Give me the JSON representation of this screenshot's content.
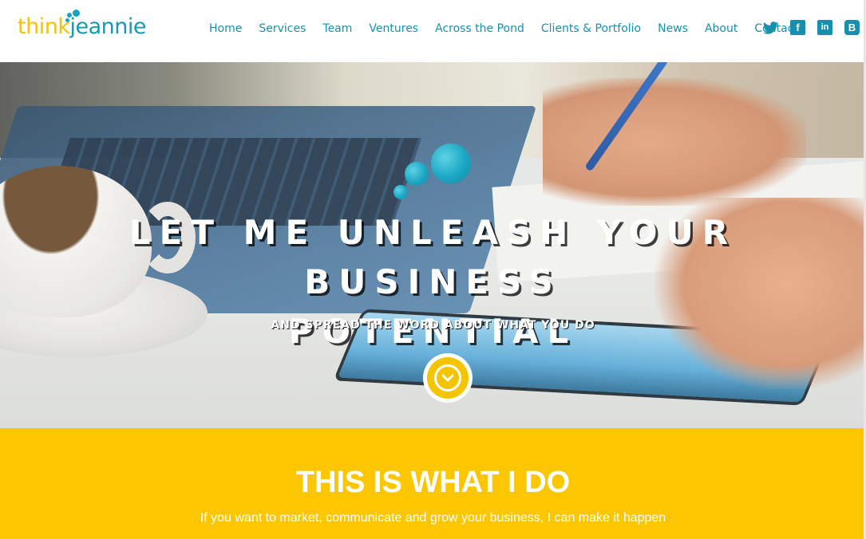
{
  "logo": {
    "think": "think",
    "jeannie": "jeannie"
  },
  "nav": {
    "items": [
      {
        "label": "Home"
      },
      {
        "label": "Services"
      },
      {
        "label": "Team"
      },
      {
        "label": "Ventures"
      },
      {
        "label": "Across the Pond"
      },
      {
        "label": "Clients & Portfolio"
      },
      {
        "label": "News"
      },
      {
        "label": "About"
      },
      {
        "label": "Contact"
      }
    ]
  },
  "social": {
    "twitter": "twitter-icon",
    "facebook": "facebook-icon",
    "linkedin": "linkedin-icon",
    "blogger": "blogger-icon"
  },
  "hero": {
    "title_line1": "LET ME UNLEASH YOUR BUSINESS",
    "title_line2": "POTENTIAL",
    "subtitle": "AND SPREAD THE WORD ABOUT WHAT YOU DO"
  },
  "what": {
    "title": "THIS IS WHAT I DO",
    "text": "If you want to market, communicate and grow your business, I can make it happen"
  },
  "colors": {
    "brand_teal": "#1890ad",
    "brand_yellow": "#fcc600",
    "logo_yellow": "#f4c20d"
  }
}
